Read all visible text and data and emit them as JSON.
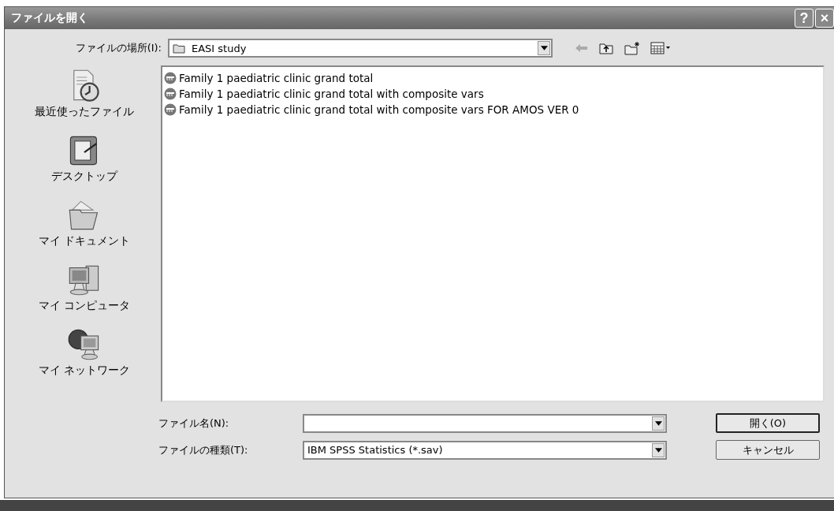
{
  "window": {
    "title": "ファイルを開く",
    "help_button": "?",
    "close_button": "×"
  },
  "look_in": {
    "label": "ファイルの場所(I):",
    "value": "EASI study"
  },
  "places": [
    {
      "label": "最近使ったファイル",
      "kind": "recent"
    },
    {
      "label": "デスクトップ",
      "kind": "desktop"
    },
    {
      "label": "マイ ドキュメント",
      "kind": "documents"
    },
    {
      "label": "マイ コンピュータ",
      "kind": "computer"
    },
    {
      "label": "マイ ネットワーク",
      "kind": "network"
    }
  ],
  "files": [
    {
      "name": "Family 1 paediatric clinic grand total",
      "selected": false
    },
    {
      "name": "Family 1 paediatric clinic grand total with composite vars",
      "selected": false
    },
    {
      "name": "Family 1 paediatric clinic grand total with composite vars FOR AMOS VER 0",
      "selected": false
    }
  ],
  "file_name": {
    "label": "ファイル名(N):"
  },
  "file_type": {
    "label": "ファイルの種類(T):",
    "value": "IBM SPSS Statistics (*.sav)"
  },
  "buttons": [
    {
      "label": "開く(O)",
      "kind": "default"
    },
    {
      "label": "キャンセル",
      "kind": "normal"
    }
  ]
}
